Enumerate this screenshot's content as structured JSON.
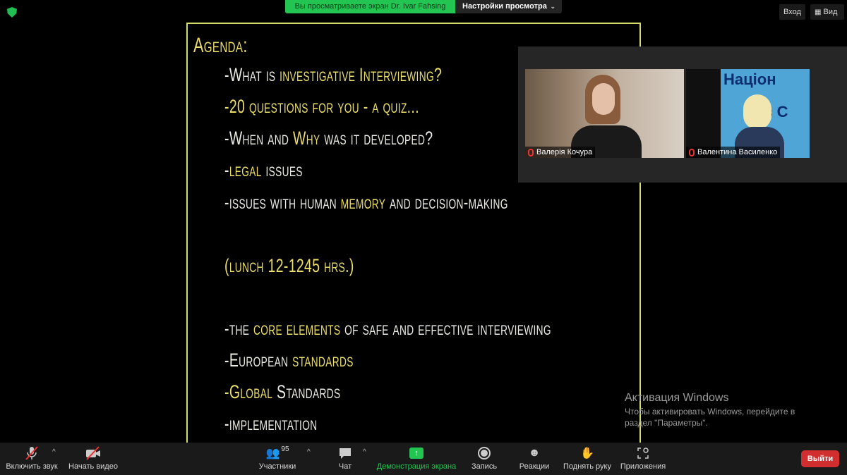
{
  "top": {
    "banner": "Вы просматриваете экран Dr. Ivar Fahsing",
    "view_settings": "Настройки просмотра",
    "login": "Вход",
    "view": "Вид"
  },
  "slide": {
    "lines": [
      [
        [
          "Agenda:",
          true
        ]
      ],
      [
        [
          "-What is ",
          false
        ],
        [
          "investigative Interviewing?",
          true
        ]
      ],
      [
        [
          "-20 questions for you - a quiz...",
          true
        ]
      ],
      [
        [
          "-When and ",
          false
        ],
        [
          "Why",
          true
        ],
        [
          " was it developed?",
          false
        ]
      ],
      [
        [
          "-",
          false
        ],
        [
          "legal",
          true
        ],
        [
          " issues",
          false
        ]
      ],
      [
        [
          "-issues with human ",
          false
        ],
        [
          "memory",
          true
        ],
        [
          " and decision-making",
          false
        ]
      ],
      [
        [
          "(lunch 12-1245 hrs.)",
          true
        ]
      ],
      [
        [
          "-the ",
          false
        ],
        [
          "core elements",
          true
        ],
        [
          " of safe and effective interviewing",
          false
        ]
      ],
      [
        [
          "-European ",
          false
        ],
        [
          "standards",
          true
        ]
      ],
      [
        [
          "-Global",
          true
        ],
        [
          " Standards",
          false
        ]
      ],
      [
        [
          "-implementation",
          false
        ]
      ]
    ]
  },
  "participants": [
    {
      "name": "Валерія Кочура",
      "muted": true
    },
    {
      "name": "Валентина Василенко",
      "muted": true
    },
    {
      "sign_text": "Націон",
      "sign_text2": "в С"
    }
  ],
  "watermark": {
    "title": "Активация Windows",
    "line1": "Чтобы активировать Windows, перейдите в",
    "line2": "раздел \"Параметры\"."
  },
  "toolbar": {
    "unmute": "Включить звук",
    "start_video": "Начать видео",
    "participants": "Участники",
    "participants_count": "95",
    "chat": "Чат",
    "share": "Демонстрация экрана",
    "record": "Запись",
    "reactions": "Реакции",
    "raise_hand": "Поднять руку",
    "apps": "Приложения",
    "leave": "Выйти"
  },
  "colors": {
    "green": "#23c552",
    "highlight": "#ecdf6a",
    "leave": "#d12f2f"
  }
}
